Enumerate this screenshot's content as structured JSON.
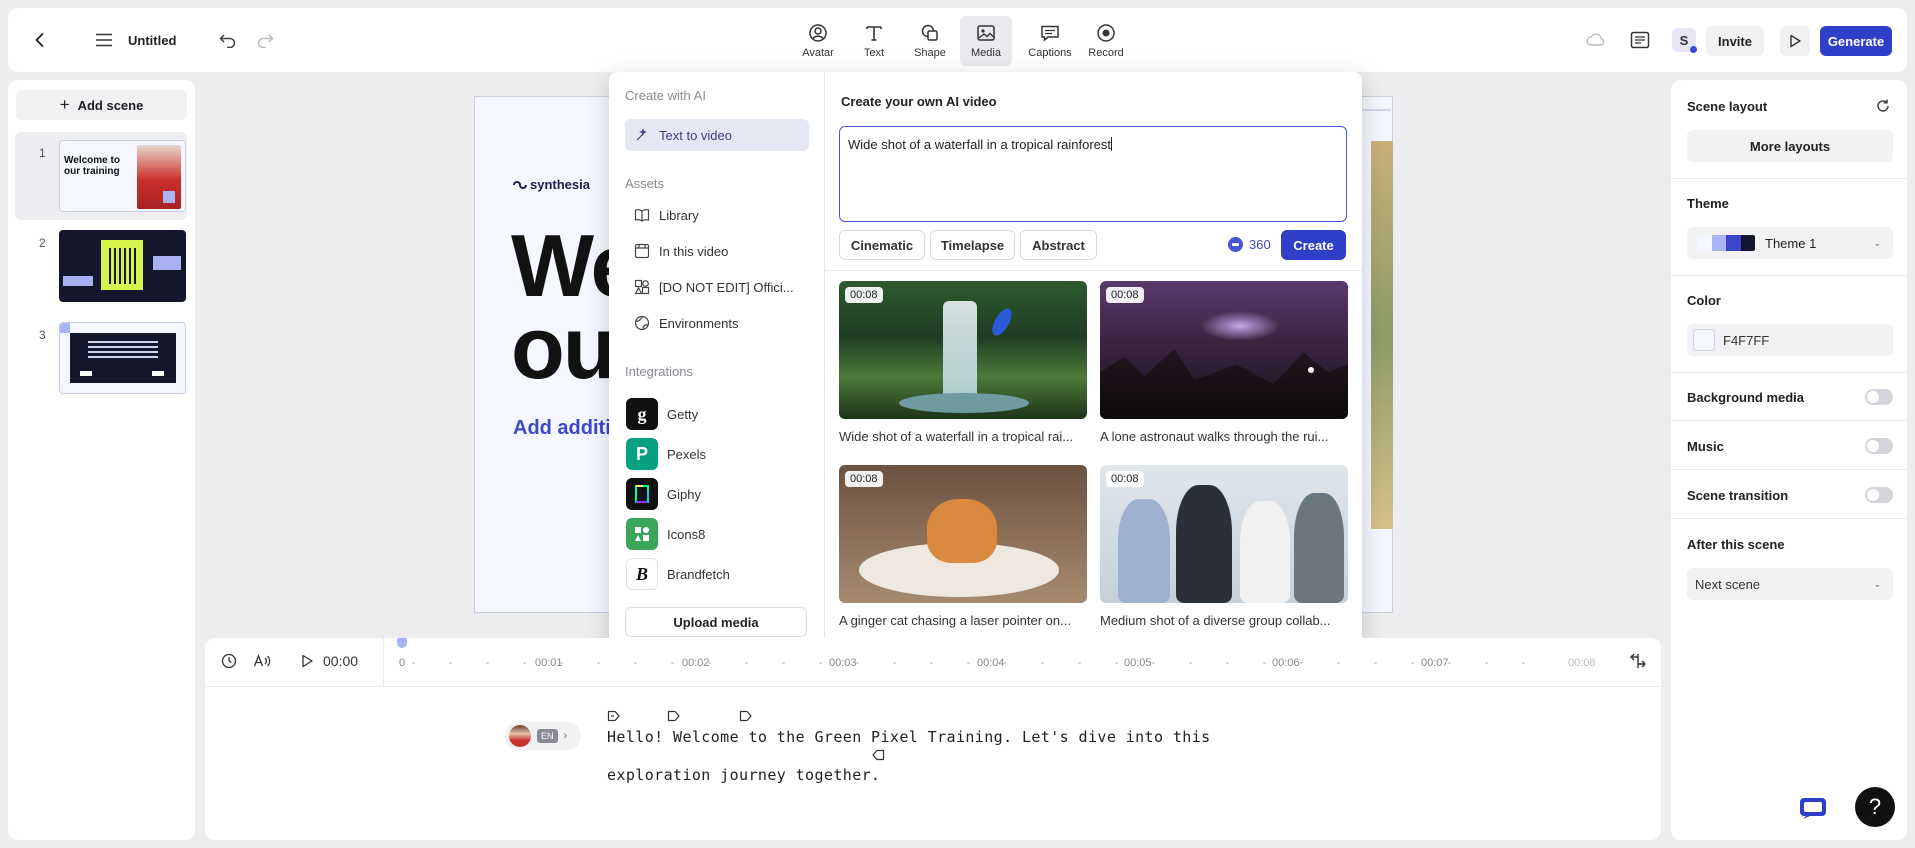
{
  "header": {
    "title": "Untitled",
    "tools": [
      {
        "label": "Avatar",
        "icon": "avatar-icon"
      },
      {
        "label": "Text",
        "icon": "text-icon"
      },
      {
        "label": "Shape",
        "icon": "shape-icon"
      },
      {
        "label": "Media",
        "icon": "media-icon",
        "active": true
      },
      {
        "label": "Captions",
        "icon": "captions-icon"
      },
      {
        "label": "Record",
        "icon": "record-icon"
      }
    ],
    "user_initial": "S",
    "invite_label": "Invite",
    "generate_label": "Generate",
    "accent": "#2f3fc9"
  },
  "scenes_panel": {
    "add_scene_label": "Add scene",
    "scenes": [
      {
        "number": "1",
        "title": "Welcome to our training"
      },
      {
        "number": "2",
        "title": ""
      },
      {
        "number": "3",
        "title": ""
      }
    ]
  },
  "canvas": {
    "brand": "synthesia",
    "headline_line1": "We",
    "headline_line2": "our",
    "subtext": "Add additio",
    "background_color": "#F4F7FF"
  },
  "media_popover": {
    "create_with_ai_title": "Create with AI",
    "text_to_video_label": "Text to video",
    "assets_title": "Assets",
    "assets": [
      "Library",
      "In this video",
      "[DO NOT EDIT] Offici...",
      "Environments"
    ],
    "integrations_title": "Integrations",
    "integrations": [
      "Getty",
      "Pexels",
      "Giphy",
      "Icons8",
      "Brandfetch"
    ],
    "upload_label": "Upload media",
    "heading": "Create your own AI video",
    "prompt_value": "Wide shot of a waterfall in a tropical rainforest",
    "styles": [
      "Cinematic",
      "Timelapse",
      "Abstract"
    ],
    "credits": "360",
    "create_label": "Create",
    "results": [
      {
        "duration": "00:08",
        "caption": "Wide shot of a waterfall in a tropical rai..."
      },
      {
        "duration": "00:08",
        "caption": "A lone astronaut walks through the rui..."
      },
      {
        "duration": "00:08",
        "caption": "A ginger cat chasing a laser pointer on..."
      },
      {
        "duration": "00:08",
        "caption": "Medium shot of a diverse group collab..."
      }
    ]
  },
  "right_panel": {
    "scene_layout_title": "Scene layout",
    "more_layouts_label": "More layouts",
    "theme_title": "Theme",
    "theme_value": "Theme 1",
    "color_title": "Color",
    "color_value": "F4F7FF",
    "background_media_label": "Background media",
    "music_label": "Music",
    "scene_transition_label": "Scene transition",
    "after_scene_title": "After this scene",
    "after_scene_value": "Next scene"
  },
  "timeline": {
    "current_time": "00:00",
    "ticks": [
      "0",
      "00:01",
      "00:02",
      "00:03",
      "00:04",
      "00:05",
      "00:06",
      "00:07",
      "00:08"
    ],
    "language_badge": "EN",
    "script_line1": "Hello! Welcome to the Green Pixel Training. Let's dive into this",
    "script_line2": "exploration journey together."
  }
}
